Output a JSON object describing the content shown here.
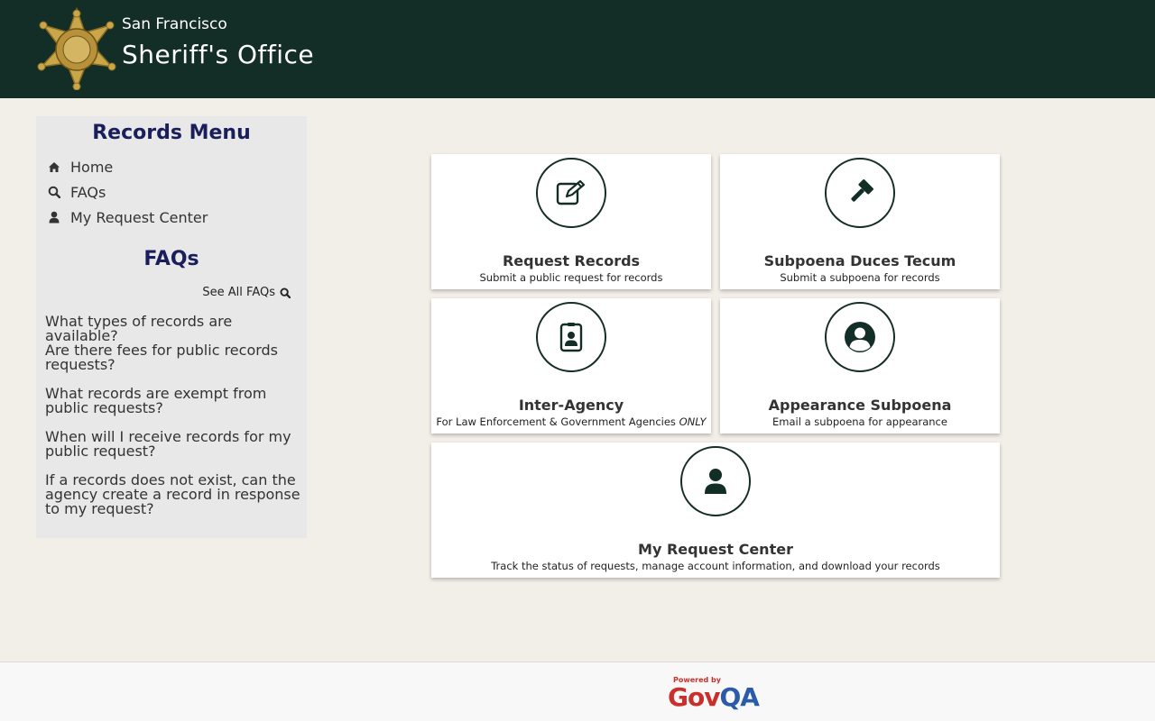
{
  "header": {
    "city": "San Francisco",
    "title": "Sheriff's Office",
    "logo_icon": "sheriff-star-badge"
  },
  "sidebar": {
    "menu_heading": "Records Menu",
    "menu_items": [
      {
        "label": "Home",
        "icon": "home-icon"
      },
      {
        "label": "FAQs",
        "icon": "search-icon"
      },
      {
        "label": "My Request Center",
        "icon": "user-icon"
      }
    ],
    "faq_heading": "FAQs",
    "see_all_label": "See All FAQs",
    "faqs": [
      "What types of records are available?",
      "Are there fees for public records requests?",
      "What records are exempt from public requests?",
      "When will I receive records for my public request?",
      "If a records does not exist, can the agency create a record in response to my request?"
    ]
  },
  "cards": [
    {
      "title": "Request Records",
      "subtitle": "Submit a public request for records",
      "icon": "edit-icon"
    },
    {
      "title": "Subpoena Duces Tecum",
      "subtitle": "Submit a subpoena for records",
      "icon": "gavel-icon"
    },
    {
      "title": "Inter-Agency",
      "subtitle": "For Law Enforcement & Government Agencies",
      "subtitle_em": "ONLY",
      "icon": "id-badge-icon"
    },
    {
      "title": "Appearance Subpoena",
      "subtitle": "Email a subpoena for appearance",
      "icon": "user-circle-icon"
    },
    {
      "title": "My Request Center",
      "subtitle": "Track the status of requests, manage account information, and download your records",
      "icon": "user-icon"
    }
  ],
  "footer": {
    "powered_by": "Powered by",
    "brand_gov": "Gov",
    "brand_qa": "QA"
  },
  "colors": {
    "header_bg": "#132e26",
    "page_bg": "#f2eee8",
    "heading": "#1a1f5c",
    "brand_red": "#c9302c",
    "brand_blue": "#2a5aa8"
  }
}
